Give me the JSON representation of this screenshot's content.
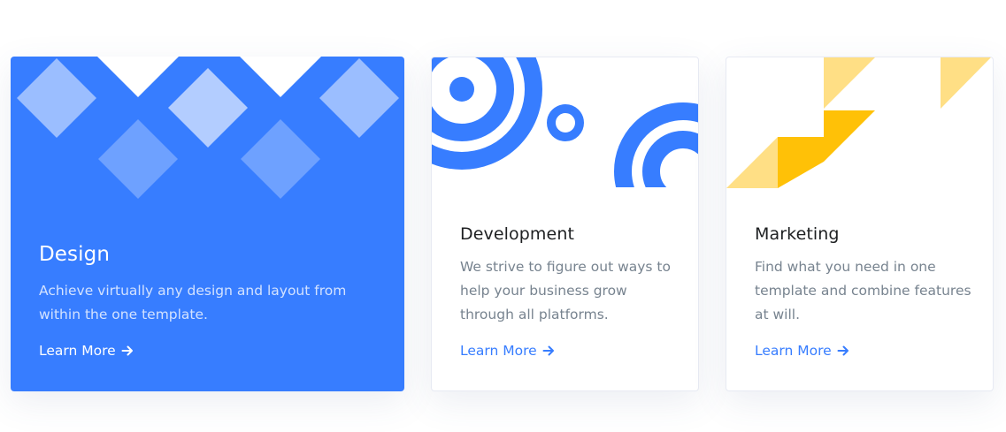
{
  "colors": {
    "primary": "#377dff",
    "accent_yellow": "#ffc107",
    "heading_dark": "#1e2022",
    "text_muted": "#77838f"
  },
  "cards": [
    {
      "title": "Design",
      "description": "Achieve virtually any design and layout from within the one template.",
      "link_label": "Learn More",
      "icon": "arrow-right-icon"
    },
    {
      "title": "Development",
      "description": "We strive to figure out ways to help your business grow through all platforms.",
      "link_label": "Learn More",
      "icon": "arrow-right-icon"
    },
    {
      "title": "Marketing",
      "description": "Find what you need in one template and combine features at will.",
      "link_label": "Learn More",
      "icon": "arrow-right-icon"
    }
  ]
}
